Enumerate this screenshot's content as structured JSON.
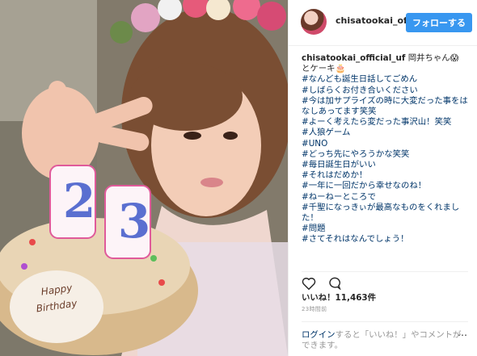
{
  "header": {
    "username": "chisatookai_official",
    "follow_label": "フォローする"
  },
  "caption": {
    "username": "chisatookai_official_uf",
    "text": "岡井ちゃん😱 とケーキ🎂",
    "hashtags": [
      "#なんども誕生日話してごめん",
      "#しばらくお付き合いください",
      "#今は加サプライズの時に大変だった事をはなしあってます笑笑",
      "#よーく考えたら変だった事沢山！笑笑",
      "#人狼ゲーム",
      "#UNO",
      "#どっち先にやろうかな笑笑",
      "#毎日誕生日がいい",
      "#それはだめか！",
      "#一年に一回だから幸せなのね！",
      "#ねーねーところで",
      "#千聖になっきぃが最高なものをくれました！",
      "#問題",
      "#さてそれはなんでしょう！"
    ]
  },
  "engagement": {
    "likes": "いいね！11,463件",
    "time": "23時間前"
  },
  "login": {
    "link": "ログイン",
    "text": "すると「いいね！」やコメントができます。"
  },
  "photo": {
    "cake_text_line1": "Happy",
    "cake_text_line2": "Birthday",
    "candle_number": "23"
  }
}
